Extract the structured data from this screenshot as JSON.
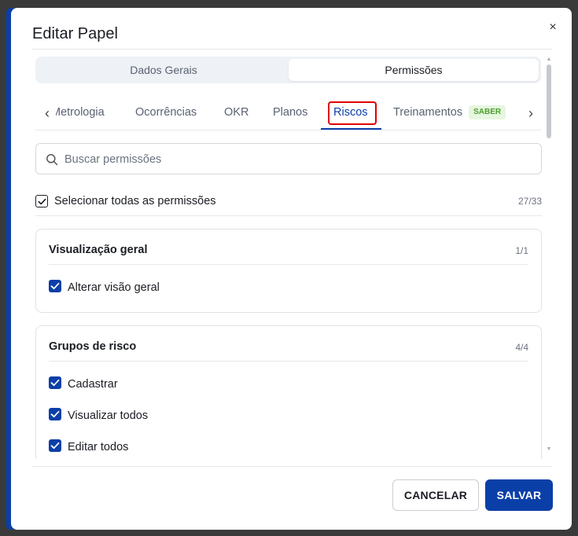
{
  "dialog": {
    "title": "Editar Papel",
    "close_icon": "×"
  },
  "segments": [
    {
      "label": "Dados Gerais",
      "selected": false
    },
    {
      "label": "Permissões",
      "selected": true
    }
  ],
  "tabs": [
    {
      "label": "Metrologia"
    },
    {
      "label": "Ocorrências"
    },
    {
      "label": "OKR"
    },
    {
      "label": "Planos"
    },
    {
      "label": "Riscos"
    },
    {
      "label": "Treinamentos",
      "badge": "SABER"
    }
  ],
  "active_tab": "Riscos",
  "search": {
    "placeholder": "Buscar permissões",
    "value": ""
  },
  "select_all": {
    "label": "Selecionar todas as permissões",
    "count": "27/33",
    "checked": true
  },
  "groups": [
    {
      "title": "Visualização geral",
      "count": "1/1",
      "permissions": [
        {
          "label": "Alterar visão geral",
          "checked": true
        }
      ]
    },
    {
      "title": "Grupos de risco",
      "count": "4/4",
      "permissions": [
        {
          "label": "Cadastrar",
          "checked": true
        },
        {
          "label": "Visualizar todos",
          "checked": true
        },
        {
          "label": "Editar todos",
          "checked": true
        }
      ]
    }
  ],
  "footer": {
    "cancel_label": "CANCELAR",
    "save_label": "SALVAR"
  },
  "colors": {
    "primary": "#0b3fa8",
    "highlight": "#e00000",
    "badge_bg": "#e6f6df",
    "badge_text": "#4b9f2c"
  }
}
